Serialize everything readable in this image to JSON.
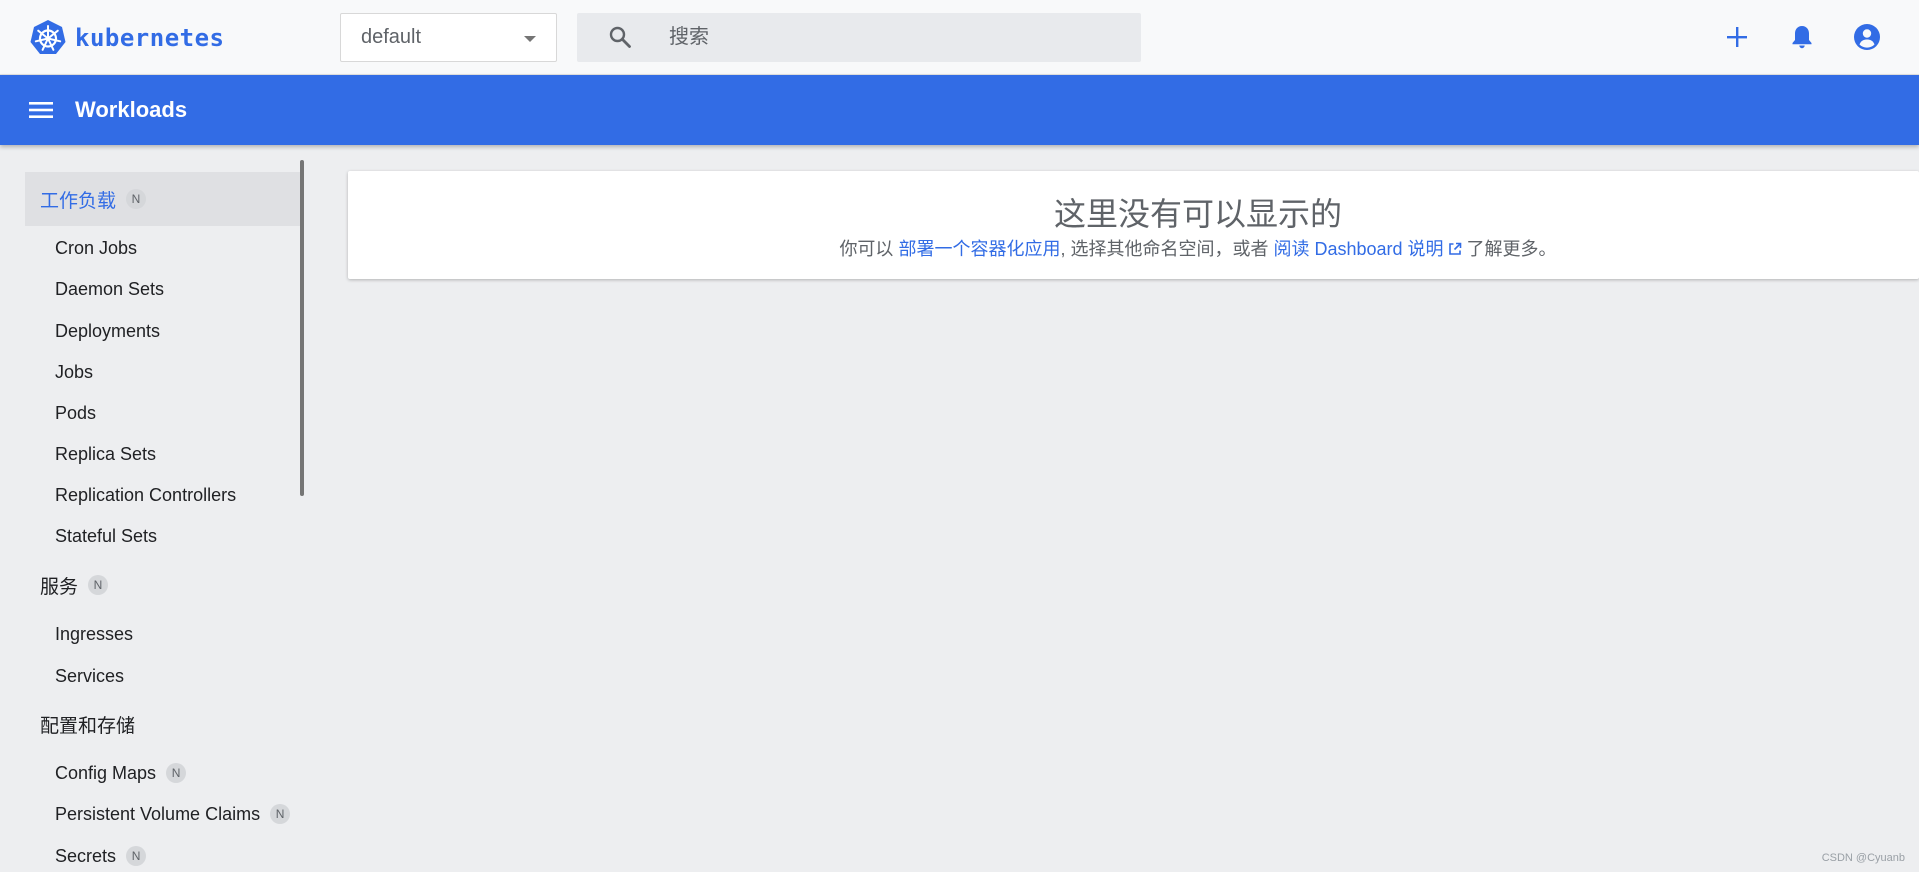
{
  "app": {
    "logo_text": "kubernetes",
    "accent_color": "#326ce5"
  },
  "namespace": {
    "selected": "default"
  },
  "search": {
    "placeholder": "搜索"
  },
  "header": {
    "title": "Workloads"
  },
  "sidebar": {
    "workloads": {
      "label": "工作负载",
      "badge": "N",
      "items": [
        "Cron Jobs",
        "Daemon Sets",
        "Deployments",
        "Jobs",
        "Pods",
        "Replica Sets",
        "Replication Controllers",
        "Stateful Sets"
      ]
    },
    "services": {
      "label": "服务",
      "badge": "N",
      "items": [
        "Ingresses",
        "Services"
      ]
    },
    "config": {
      "label": "配置和存储",
      "items": [
        {
          "label": "Config Maps",
          "badge": "N"
        },
        {
          "label": "Persistent Volume Claims",
          "badge": "N"
        },
        {
          "label": "Secrets",
          "badge": "N"
        }
      ]
    }
  },
  "empty_state": {
    "title": "这里没有可以显示的",
    "prefix": "你可以 ",
    "deploy_link": "部署一个容器化应用",
    "middle": ", 选择其他命名空间，或者 ",
    "docs_link": "阅读 Dashboard 说明",
    "suffix": " 了解更多。"
  },
  "watermark": "CSDN @Cyuanb"
}
